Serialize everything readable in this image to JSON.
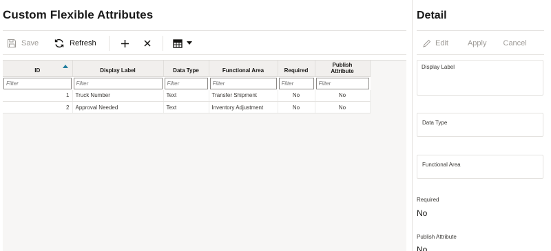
{
  "page": {
    "title": "Custom Flexible Attributes"
  },
  "toolbar": {
    "save_label": "Save",
    "refresh_label": "Refresh",
    "save_icon": "save-icon",
    "refresh_icon": "refresh-icon",
    "add_icon": "plus-icon",
    "delete_icon": "close-icon",
    "view_icon": "table-view-icon"
  },
  "grid": {
    "columns": [
      {
        "label": "ID",
        "sorted": "ascending"
      },
      {
        "label": "Display Label"
      },
      {
        "label": "Data Type"
      },
      {
        "label": "Functional Area"
      },
      {
        "label": "Required"
      },
      {
        "label": "Publish Attribute"
      }
    ],
    "filter_placeholder": "Filter",
    "rows": [
      {
        "id": "1",
        "display_label": "Truck Number",
        "data_type": "Text",
        "functional_area": "Transfer Shipment",
        "required": "No",
        "publish": "No"
      },
      {
        "id": "2",
        "display_label": "Approval Needed",
        "data_type": "Text",
        "functional_area": "Inventory Adjustment",
        "required": "No",
        "publish": "No"
      }
    ]
  },
  "detail": {
    "title": "Detail",
    "edit_label": "Edit",
    "apply_label": "Apply",
    "cancel_label": "Cancel",
    "edit_icon": "pencil-icon",
    "fields": {
      "display_label": "Display Label",
      "data_type": "Data Type",
      "functional_area": "Functional Area"
    },
    "required": {
      "label": "Required",
      "value": "No"
    },
    "publish": {
      "label": "Publish Attribute",
      "value": "No"
    }
  },
  "colors": {
    "accent": "#227e9e",
    "text": "#161513",
    "disabled": "#9e9b97",
    "border": "#e4e2df"
  }
}
